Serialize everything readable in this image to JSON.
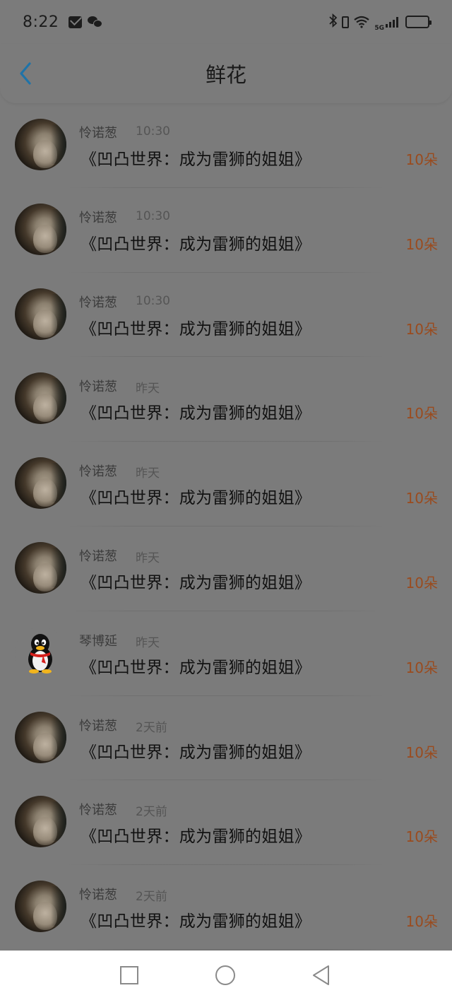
{
  "status_bar": {
    "time": "8:22",
    "network": "5G",
    "icons": [
      "mail-icon",
      "wechat-icon",
      "bluetooth-icon",
      "phone-vibrate-icon",
      "wifi-icon",
      "signal-icon",
      "battery-icon"
    ],
    "battery_level": 0.35
  },
  "header": {
    "title": "鲜花",
    "back_icon": "chevron-left-icon"
  },
  "colors": {
    "accent_back": "#1f73a8",
    "count_color": "#9a4b1e",
    "dimmed_overlay": "#7b7b7b"
  },
  "rows": [
    {
      "name": "怜诺葱",
      "time": "10:30",
      "title": "《凹凸世界：成为雷狮的姐姐》",
      "count": "10朵",
      "avatar": "photo"
    },
    {
      "name": "怜诺葱",
      "time": "10:30",
      "title": "《凹凸世界：成为雷狮的姐姐》",
      "count": "10朵",
      "avatar": "photo"
    },
    {
      "name": "怜诺葱",
      "time": "10:30",
      "title": "《凹凸世界：成为雷狮的姐姐》",
      "count": "10朵",
      "avatar": "photo"
    },
    {
      "name": "怜诺葱",
      "time": "昨天",
      "title": "《凹凸世界：成为雷狮的姐姐》",
      "count": "10朵",
      "avatar": "photo"
    },
    {
      "name": "怜诺葱",
      "time": "昨天",
      "title": "《凹凸世界：成为雷狮的姐姐》",
      "count": "10朵",
      "avatar": "photo"
    },
    {
      "name": "怜诺葱",
      "time": "昨天",
      "title": "《凹凸世界：成为雷狮的姐姐》",
      "count": "10朵",
      "avatar": "photo"
    },
    {
      "name": "琴博延",
      "time": "昨天",
      "title": "《凹凸世界：成为雷狮的姐姐》",
      "count": "10朵",
      "avatar": "penguin"
    },
    {
      "name": "怜诺葱",
      "time": "2天前",
      "title": "《凹凸世界：成为雷狮的姐姐》",
      "count": "10朵",
      "avatar": "photo"
    },
    {
      "name": "怜诺葱",
      "time": "2天前",
      "title": "《凹凸世界：成为雷狮的姐姐》",
      "count": "10朵",
      "avatar": "photo"
    },
    {
      "name": "怜诺葱",
      "time": "2天前",
      "title": "《凹凸世界：成为雷狮的姐姐》",
      "count": "10朵",
      "avatar": "photo"
    }
  ],
  "navbar": {
    "icons": [
      "recents-square-icon",
      "home-circle-icon",
      "back-triangle-icon"
    ]
  }
}
